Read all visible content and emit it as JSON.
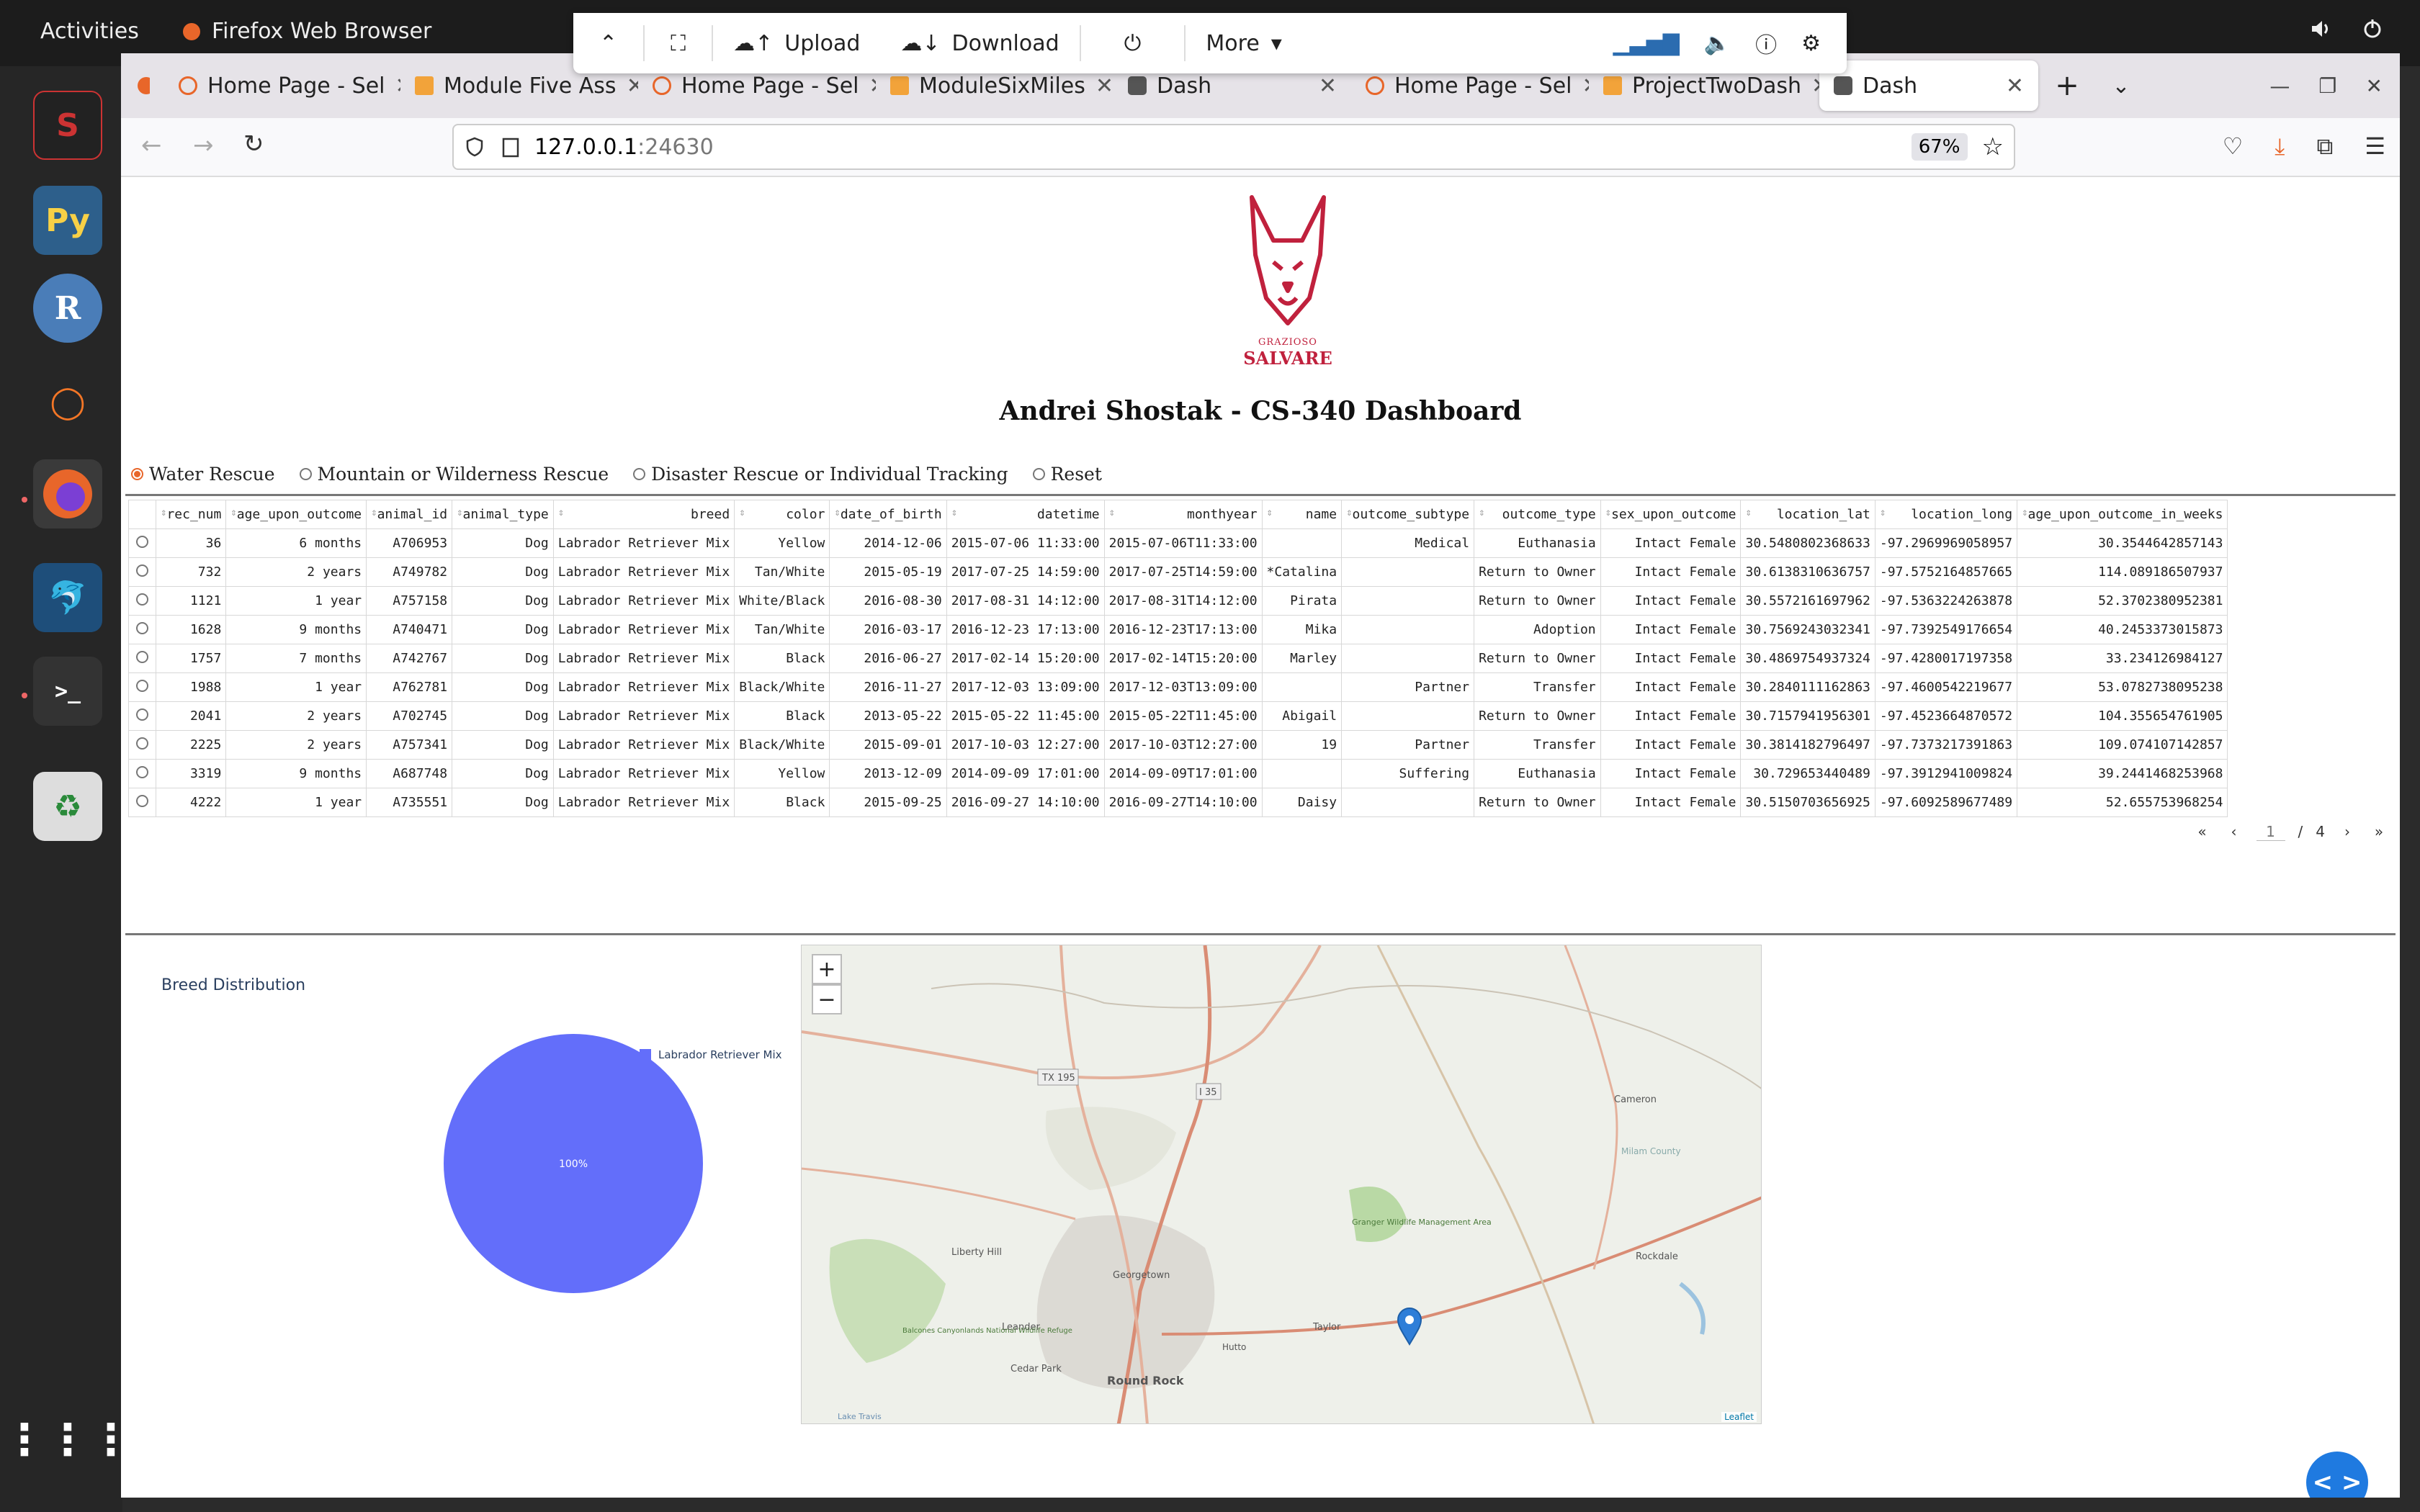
{
  "topbar": {
    "activities": "Activities",
    "app_name": "Firefox Web Browser"
  },
  "remote_toolbar": {
    "upload": "Upload",
    "download": "Download",
    "more": "More"
  },
  "tabs": [
    {
      "label": "Home Page - Sel",
      "icon": "loading-icon"
    },
    {
      "label": "Module Five Ass",
      "icon": "book-icon"
    },
    {
      "label": "Home Page - Sel",
      "icon": "loading-icon"
    },
    {
      "label": "ModuleSixMiles",
      "icon": "book-icon"
    },
    {
      "label": "Dash",
      "icon": "dash-icon"
    },
    {
      "label": "Home Page - Sel",
      "icon": "loading-icon"
    },
    {
      "label": "ProjectTwoDash",
      "icon": "book-icon"
    },
    {
      "label": "Dash",
      "icon": "dash-icon",
      "active": true
    }
  ],
  "urlbar": {
    "host": "127.0.0.1",
    "port": ":24630",
    "zoom": "67%"
  },
  "logo": {
    "line1": "GRAZIOSO",
    "line2": "SALVARE"
  },
  "dashboard": {
    "title": "Andrei Shostak - CS-340 Dashboard"
  },
  "filters": [
    {
      "label": "Water Rescue",
      "selected": true
    },
    {
      "label": "Mountain or Wilderness Rescue",
      "selected": false
    },
    {
      "label": "Disaster Rescue or Individual Tracking",
      "selected": false
    },
    {
      "label": "Reset",
      "selected": false
    }
  ],
  "table": {
    "columns": [
      "rec_num",
      "age_upon_outcome",
      "animal_id",
      "animal_type",
      "breed",
      "color",
      "date_of_birth",
      "datetime",
      "monthyear",
      "name",
      "outcome_subtype",
      "outcome_type",
      "sex_upon_outcome",
      "location_lat",
      "location_long",
      "age_upon_outcome_in_weeks"
    ],
    "rows": [
      [
        "36",
        "6 months",
        "A706953",
        "Dog",
        "Labrador Retriever Mix",
        "Yellow",
        "2014-12-06",
        "2015-07-06 11:33:00",
        "2015-07-06T11:33:00",
        "",
        "Medical",
        "Euthanasia",
        "Intact Female",
        "30.5480802368633",
        "-97.2969969058957",
        "30.3544642857143"
      ],
      [
        "732",
        "2 years",
        "A749782",
        "Dog",
        "Labrador Retriever Mix",
        "Tan/White",
        "2015-05-19",
        "2017-07-25 14:59:00",
        "2017-07-25T14:59:00",
        "*Catalina",
        "",
        "Return to Owner",
        "Intact Female",
        "30.6138310636757",
        "-97.5752164857665",
        "114.089186507937"
      ],
      [
        "1121",
        "1 year",
        "A757158",
        "Dog",
        "Labrador Retriever Mix",
        "White/Black",
        "2016-08-30",
        "2017-08-31 14:12:00",
        "2017-08-31T14:12:00",
        "Pirata",
        "",
        "Return to Owner",
        "Intact Female",
        "30.5572161697962",
        "-97.5363224263878",
        "52.3702380952381"
      ],
      [
        "1628",
        "9 months",
        "A740471",
        "Dog",
        "Labrador Retriever Mix",
        "Tan/White",
        "2016-03-17",
        "2016-12-23 17:13:00",
        "2016-12-23T17:13:00",
        "Mika",
        "",
        "Adoption",
        "Intact Female",
        "30.7569243032341",
        "-97.7392549176654",
        "40.2453373015873"
      ],
      [
        "1757",
        "7 months",
        "A742767",
        "Dog",
        "Labrador Retriever Mix",
        "Black",
        "2016-06-27",
        "2017-02-14 15:20:00",
        "2017-02-14T15:20:00",
        "Marley",
        "",
        "Return to Owner",
        "Intact Female",
        "30.4869754937324",
        "-97.4280017197358",
        "33.234126984127"
      ],
      [
        "1988",
        "1 year",
        "A762781",
        "Dog",
        "Labrador Retriever Mix",
        "Black/White",
        "2016-11-27",
        "2017-12-03 13:09:00",
        "2017-12-03T13:09:00",
        "",
        "Partner",
        "Transfer",
        "Intact Female",
        "30.2840111162863",
        "-97.4600542219677",
        "53.0782738095238"
      ],
      [
        "2041",
        "2 years",
        "A702745",
        "Dog",
        "Labrador Retriever Mix",
        "Black",
        "2013-05-22",
        "2015-05-22 11:45:00",
        "2015-05-22T11:45:00",
        "Abigail",
        "",
        "Return to Owner",
        "Intact Female",
        "30.7157941956301",
        "-97.4523664870572",
        "104.355654761905"
      ],
      [
        "2225",
        "2 years",
        "A757341",
        "Dog",
        "Labrador Retriever Mix",
        "Black/White",
        "2015-09-01",
        "2017-10-03 12:27:00",
        "2017-10-03T12:27:00",
        "19",
        "Partner",
        "Transfer",
        "Intact Female",
        "30.3814182796497",
        "-97.7373217391863",
        "109.074107142857"
      ],
      [
        "3319",
        "9 months",
        "A687748",
        "Dog",
        "Labrador Retriever Mix",
        "Yellow",
        "2013-12-09",
        "2014-09-09 17:01:00",
        "2014-09-09T17:01:00",
        "",
        "Suffering",
        "Euthanasia",
        "Intact Female",
        "30.729653440489",
        "-97.3912941009824",
        "39.2441468253968"
      ],
      [
        "4222",
        "1 year",
        "A735551",
        "Dog",
        "Labrador Retriever Mix",
        "Black",
        "2015-09-25",
        "2016-09-27 14:10:00",
        "2016-09-27T14:10:00",
        "Daisy",
        "",
        "Return to Owner",
        "Intact Female",
        "30.5150703656925",
        "-97.6092589677489",
        "52.655753968254"
      ]
    ]
  },
  "pager": {
    "current": "1",
    "sep": "/",
    "total": "4"
  },
  "pie": {
    "title": "Breed Distribution",
    "slice_label": "100%",
    "legend": "Labrador Retriever Mix",
    "color": "#636efa"
  },
  "chart_data": {
    "type": "pie",
    "title": "Breed Distribution",
    "categories": [
      "Labrador Retriever Mix"
    ],
    "values": [
      100
    ],
    "legend_position": "top-right"
  },
  "map": {
    "attribution": "Leaflet",
    "labels": [
      "TX 195",
      "I 35",
      "Cameron",
      "Milam County",
      "Granger Wildlife Management Area",
      "Liberty Hill",
      "Georgetown",
      "Taylor",
      "Rockdale",
      "Leander",
      "Cedar Park",
      "Round Rock",
      "Hutto",
      "Balcones Canyonlands National Wildlife Refuge",
      "Lake Travis"
    ],
    "zoom_in": "+",
    "zoom_out": "−"
  },
  "fab": {
    "label": "< >"
  }
}
